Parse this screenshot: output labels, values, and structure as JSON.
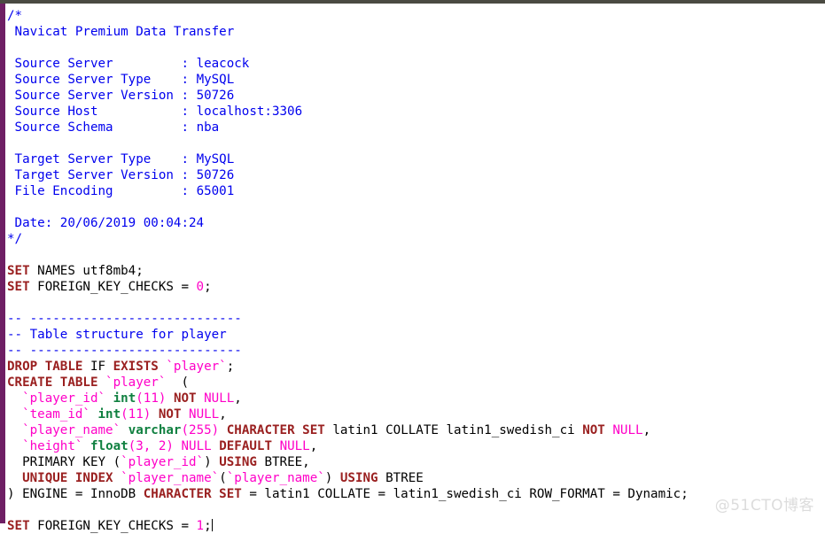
{
  "window": {
    "top_bar_color": "#4a4a42",
    "gutter_color": "#6e1f64",
    "background_color": "#ffffff"
  },
  "theme": {
    "comment_color": "#0000ee",
    "keyword_color": "#9a2020",
    "datatype_color": "#108040",
    "identifier_color": "#ff00c8",
    "literal_color": "#ff00c8",
    "plain_color": "#000000"
  },
  "gutter": {
    "fold_marker_name": "fold-marker"
  },
  "header_comment": {
    "open": "/*",
    "title": " Navicat Premium Data Transfer",
    "blank1": "",
    "fields": [
      {
        "label": " Source Server         ",
        "sep": ": ",
        "value": "leacock"
      },
      {
        "label": " Source Server Type    ",
        "sep": ": ",
        "value": "MySQL"
      },
      {
        "label": " Source Server Version ",
        "sep": ": ",
        "value": "50726"
      },
      {
        "label": " Source Host           ",
        "sep": ": ",
        "value": "localhost:3306"
      },
      {
        "label": " Source Schema         ",
        "sep": ": ",
        "value": "nba"
      },
      {
        "label": "",
        "sep": "",
        "value": ""
      },
      {
        "label": " Target Server Type    ",
        "sep": ": ",
        "value": "MySQL"
      },
      {
        "label": " Target Server Version ",
        "sep": ": ",
        "value": "50726"
      },
      {
        "label": " File Encoding         ",
        "sep": ": ",
        "value": "65001"
      }
    ],
    "blank2": "",
    "date_line": " Date: 20/06/2019 00:04:24",
    "close": "*/"
  },
  "statements": {
    "set_names": {
      "kw": "SET",
      "rest": " NAMES utf8mb4;"
    },
    "fk_off": {
      "kw": "SET",
      "mid": " FOREIGN_KEY_CHECKS = ",
      "value": "0",
      "end": ";"
    },
    "fk_on": {
      "kw": "SET",
      "mid": " FOREIGN_KEY_CHECKS = ",
      "value": "1",
      "end": ";"
    }
  },
  "table_comment": {
    "rule_top": "-- ----------------------------",
    "text": "-- Table structure for player",
    "rule_bottom": "-- ----------------------------"
  },
  "ddl": {
    "drop": {
      "kw1": "DROP TABLE",
      "plain1": " IF ",
      "kw2": "EXISTS",
      "plain2": " ",
      "ident": "`player`",
      "end": ";"
    },
    "create": {
      "kw": "CREATE TABLE",
      "space1": " ",
      "ident": "`player`",
      "end": "  ("
    },
    "columns": [
      {
        "indent": "  ",
        "ident": "`player_id`",
        "space1": " ",
        "type": "int",
        "type_args": "(11)",
        "space2": " ",
        "kw": "NOT",
        "space3": " ",
        "nullable": "NULL",
        "tail": ",",
        "extra_plain": "",
        "extra_kw": "",
        "extra_plain2": "",
        "default_kw": "",
        "default_val": ""
      },
      {
        "indent": "  ",
        "ident": "`team_id`",
        "space1": " ",
        "type": "int",
        "type_args": "(11)",
        "space2": " ",
        "kw": "NOT",
        "space3": " ",
        "nullable": "NULL",
        "tail": ",",
        "extra_plain": "",
        "extra_kw": "",
        "extra_plain2": "",
        "default_kw": "",
        "default_val": ""
      }
    ],
    "player_name_line": {
      "indent": "  ",
      "ident": "`player_name`",
      "space1": " ",
      "type": "varchar",
      "type_args": "(255)",
      "space2": " ",
      "kw_character": "CHARACTER",
      "space3": " ",
      "kw_set": "SET",
      "plain_charset": " latin1 COLLATE latin1_swedish_ci ",
      "kw_not": "NOT",
      "space4": " ",
      "nullable": "NULL",
      "tail": ","
    },
    "height_line": {
      "indent": "  ",
      "ident": "`height`",
      "space1": " ",
      "type": "float",
      "type_args": "(3, 2)",
      "space2": " ",
      "nullable1": "NULL",
      "space3": " ",
      "kw_default": "DEFAULT",
      "space4": " ",
      "nullable2": "NULL",
      "tail": ","
    },
    "primary_key_line": {
      "indent": "  ",
      "plain1": "PRIMARY KEY (",
      "ident": "`player_id`",
      "plain2": ") ",
      "kw_using": "USING",
      "plain3": " BTREE,"
    },
    "unique_index_line": {
      "indent": "  ",
      "kw_unique": "UNIQUE INDEX",
      "space1": " ",
      "ident1": "`player_name`",
      "plain1": "(",
      "ident2": "`player_name`",
      "plain2": ") ",
      "kw_using": "USING",
      "plain3": " BTREE"
    },
    "close_line": {
      "plain1": ") ENGINE = InnoDB ",
      "kw_character": "CHARACTER",
      "space1": " ",
      "kw_set": "SET",
      "plain2": " = latin1 COLLATE = latin1_swedish_ci ROW_FORMAT = Dynamic;"
    }
  },
  "watermark": {
    "text": "@51CTO博客"
  }
}
